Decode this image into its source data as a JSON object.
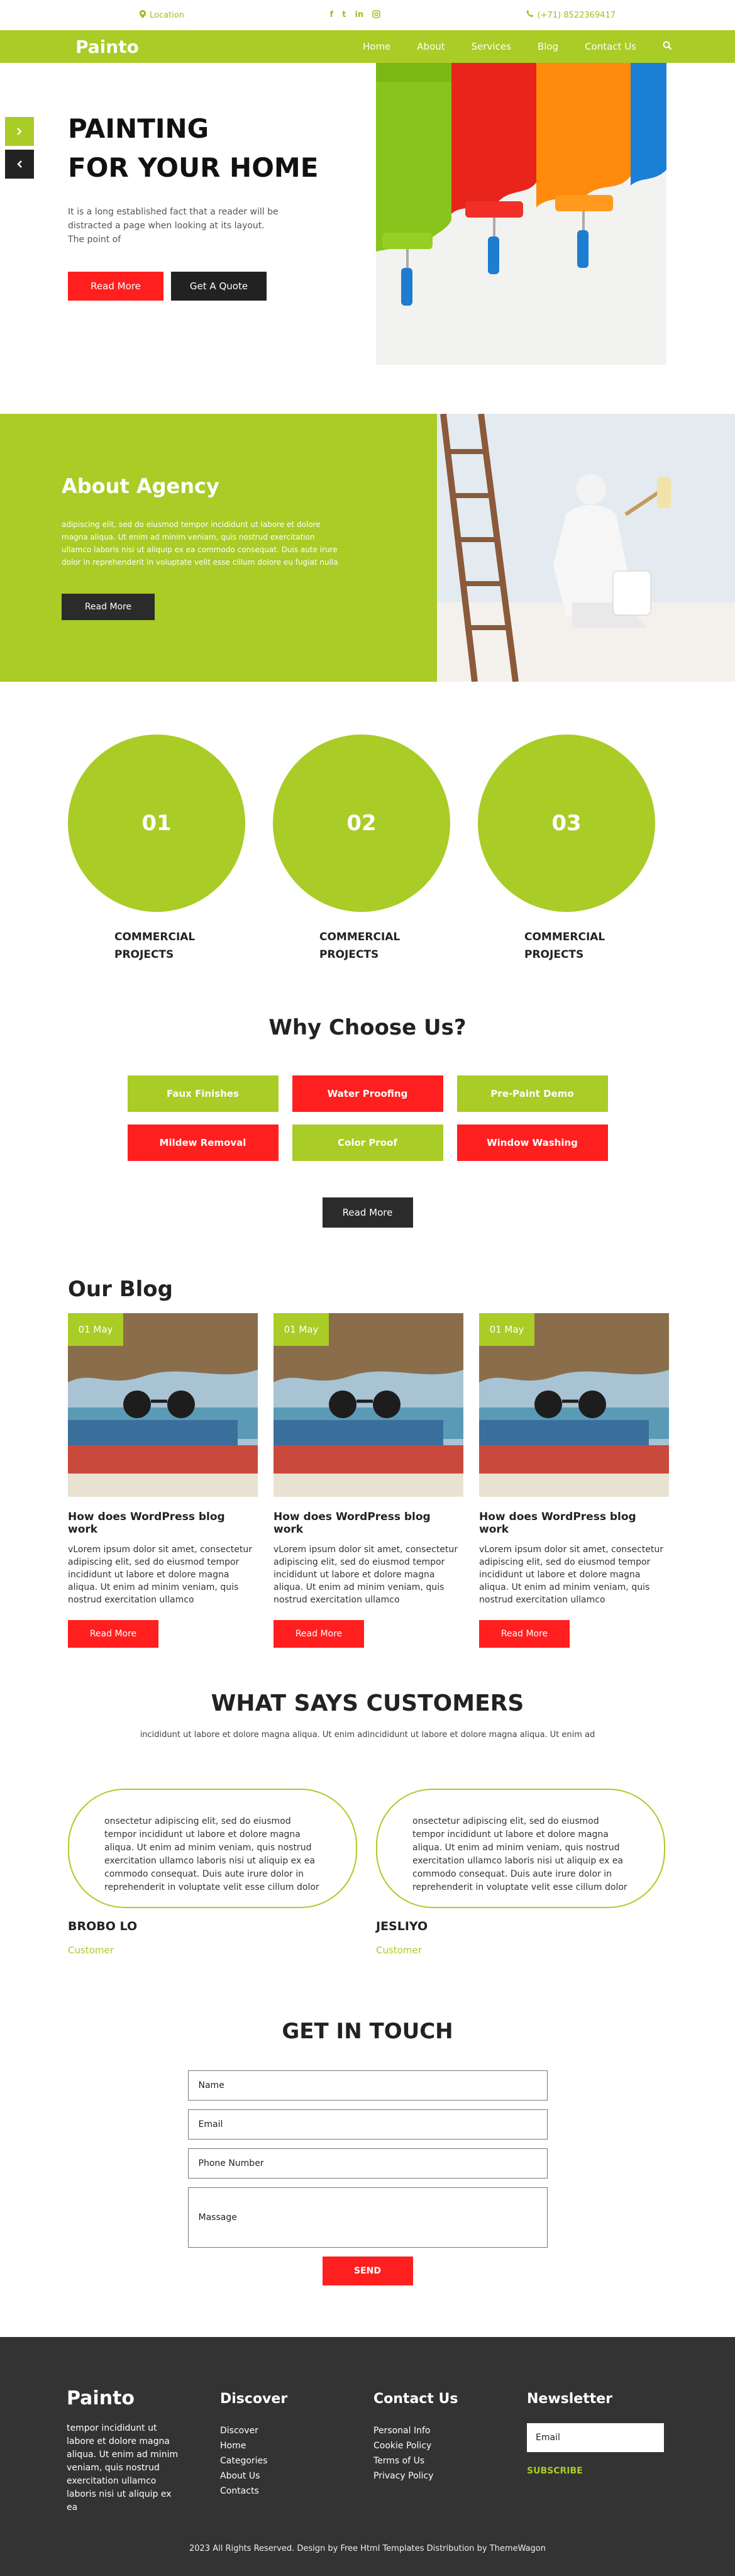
{
  "topbar": {
    "location": "Location",
    "phone": "(+71) 8522369417",
    "socials": [
      "f",
      "t",
      "in",
      "ig"
    ]
  },
  "header": {
    "brand": "Painto",
    "nav": [
      "Home",
      "About",
      "Services",
      "Blog",
      "Contact Us"
    ]
  },
  "hero": {
    "title_line1": "PAINTING",
    "title_line2": "FOR YOUR HOME",
    "description": "It is a long established fact that a reader will be distracted a page when looking at its layout. The point of",
    "btn_read_more": "Read More",
    "btn_quote": "Get A Quote"
  },
  "about": {
    "title": "About Agency",
    "description": "adipiscing elit, sed do eiusmod tempor incididunt ut labore et dolore magna aliqua. Ut enim ad minim veniam, quis nostrud exercitation ullamco laboris nisi ut aliquip ex ea commodo consequat. Duis aute irure dolor in reprehenderit in voluptate velit esse cillum dolore eu fugiat nulla",
    "btn": "Read More"
  },
  "stats": [
    {
      "number": "01",
      "label": "COMMERCIAL PROJECTS"
    },
    {
      "number": "02",
      "label": "COMMERCIAL PROJECTS"
    },
    {
      "number": "03",
      "label": "COMMERCIAL PROJECTS"
    }
  ],
  "why": {
    "title": "Why Choose Us?",
    "items": [
      "Faux Finishes",
      "Water Proofing",
      "Pre-Paint Demo",
      "Mildew Removal",
      "Color Proof",
      "Window Washing"
    ],
    "btn": "Read More"
  },
  "blog": {
    "title": "Our Blog",
    "posts": [
      {
        "date": "01 May",
        "title": "How does WordPress blog work",
        "text": "vLorem ipsum dolor sit amet, consectetur adipiscing elit, sed do eiusmod tempor incididunt ut labore et dolore magna aliqua. Ut enim ad minim veniam, quis nostrud exercitation ullamco",
        "btn": "Read More"
      },
      {
        "date": "01 May",
        "title": "How does WordPress blog work",
        "text": "vLorem ipsum dolor sit amet, consectetur adipiscing elit, sed do eiusmod tempor incididunt ut labore et dolore magna aliqua. Ut enim ad minim veniam, quis nostrud exercitation ullamco",
        "btn": "Read More"
      },
      {
        "date": "01 May",
        "title": "How does WordPress blog work",
        "text": "vLorem ipsum dolor sit amet, consectetur adipiscing elit, sed do eiusmod tempor incididunt ut labore et dolore magna aliqua. Ut enim ad minim veniam, quis nostrud exercitation ullamco",
        "btn": "Read More"
      }
    ]
  },
  "testimonials": {
    "title": "WHAT SAYS CUSTOMERS",
    "subtitle": "incididunt ut labore et dolore magna aliqua. Ut enim adincididunt ut labore et dolore magna aliqua. Ut enim ad",
    "items": [
      {
        "text": "onsectetur adipiscing elit, sed do eiusmod tempor incididunt ut labore et dolore magna aliqua. Ut enim ad minim veniam, quis nostrud exercitation ullamco laboris nisi ut aliquip ex ea commodo consequat. Duis aute irure dolor in reprehenderit in voluptate velit esse cillum dolor",
        "name": "BROBO LO",
        "role": "Customer"
      },
      {
        "text": "onsectetur adipiscing elit, sed do eiusmod tempor incididunt ut labore et dolore magna aliqua. Ut enim ad minim veniam, quis nostrud exercitation ullamco laboris nisi ut aliquip ex ea commodo consequat. Duis aute irure dolor in reprehenderit in voluptate velit esse cillum dolor",
        "name": "JESLIYO",
        "role": "Customer"
      }
    ]
  },
  "contact": {
    "title": "GET IN TOUCH",
    "placeholders": [
      "Name",
      "Email",
      "Phone Number",
      "Massage"
    ],
    "btn": "SEND"
  },
  "footer": {
    "brand": "Painto",
    "brand_text": "tempor incididunt ut labore et dolore magna aliqua. Ut enim ad minim veniam, quis nostrud exercitation ullamco laboris nisi ut aliquip ex ea",
    "discover_title": "Discover",
    "discover_links": [
      "Discover",
      "Home",
      "Categories",
      "About Us",
      "Contacts"
    ],
    "contact_title": "Contact Us",
    "contact_links": [
      "Personal Info",
      "Cookie Policy",
      "Terms of Us",
      "Privacy Policy"
    ],
    "newsletter_title": "Newsletter",
    "newsletter_placeholder": "Email",
    "subscribe": "SUBSCRIBE",
    "copyright": "2023 All Rights Reserved. Design by Free Html Templates Distribution by ThemeWagon"
  },
  "colors": {
    "accent_green": "#a9cc26",
    "accent_red": "#ff1f1f",
    "dark": "#2b2b2b",
    "footer_bg": "#333333"
  }
}
